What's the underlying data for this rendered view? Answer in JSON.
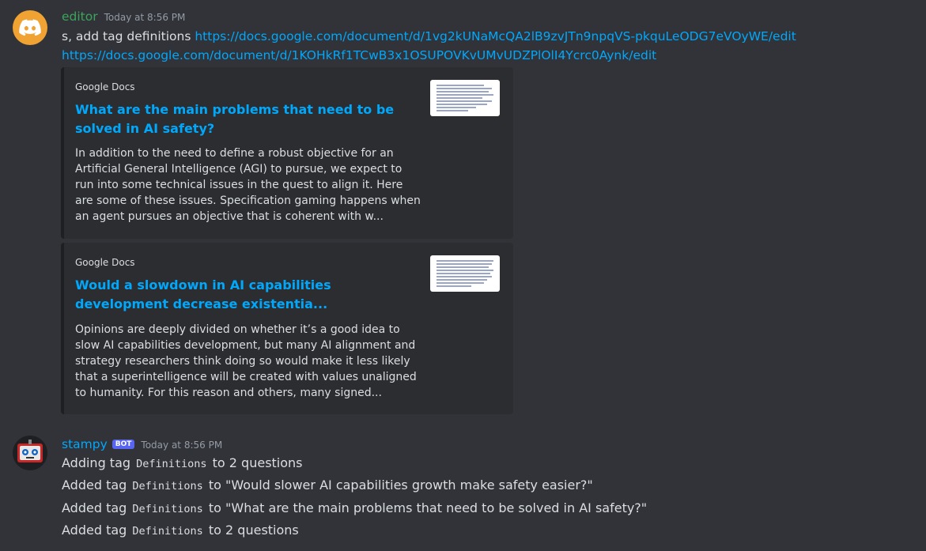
{
  "messages": {
    "editor": {
      "username": "editor",
      "username_color": "#3ba55c",
      "timestamp": "Today at 8:56 PM",
      "text_prefix": "s, add tag definitions",
      "link1": "https://docs.google.com/document/d/1vg2kUNaMcQA2lB9zvJTn9npqVS-pkquLeODG7eVOyWE/edit",
      "link2": "https://docs.google.com/document/d/1KOHkRf1TCwB3x1OSUPOVKvUMvUDZPlOlI4Ycrc0Aynk/edit",
      "embeds": [
        {
          "provider": "Google Docs",
          "title": "What are the main problems that need to be solved in AI safety?",
          "description": "In addition to the need to define a robust objective for an Artificial General Intelligence (AGI) to pursue, we expect to run into some technical issues in the quest to align it. Here are some of these issues. Specification gaming happens when an agent pursues an objective that is coherent with w..."
        },
        {
          "provider": "Google Docs",
          "title": "Would a slowdown in AI capabilities development decrease existentia...",
          "description": "Opinions are deeply divided on whether it’s a good idea to slow AI capabilities development, but many AI alignment and strategy researchers think doing so would make it less likely that a superintelligence will be created with values unaligned to humanity. For this reason and others, many signed..."
        }
      ]
    },
    "stampy": {
      "username": "stampy",
      "username_color": "#00a8fc",
      "bot_badge": "BOT",
      "timestamp": "Today at 8:56 PM",
      "lines": [
        {
          "pre": "Adding tag",
          "code": "Definitions",
          "post": "to 2 questions"
        },
        {
          "pre": "Added tag",
          "code": "Definitions",
          "post": "to \"Would slower AI capabilities growth make safety easier?\""
        },
        {
          "pre": "Added tag",
          "code": "Definitions",
          "post": "to \"What are the main problems that need to be solved in AI safety?\""
        },
        {
          "pre": "Added tag",
          "code": "Definitions",
          "post": "to 2 questions"
        }
      ]
    }
  }
}
